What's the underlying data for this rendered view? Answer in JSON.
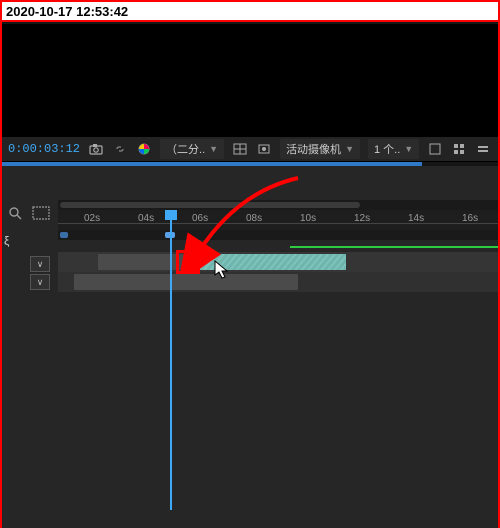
{
  "timestamp": "2020-10-17 12:53:42",
  "toolbar": {
    "timecode": "0:00:03:12",
    "comp_dropdown": "（二分..",
    "camera_dropdown": "活动摄像机",
    "view_dropdown": "1 个.."
  },
  "ruler": {
    "ticks": [
      "02s",
      "04s",
      "06s",
      "08s",
      "10s",
      "12s",
      "14s",
      "16s"
    ]
  },
  "left": {
    "axis": "ξ"
  },
  "icons": {
    "snapshot": "camera-icon",
    "link": "link-icon",
    "color": "color-wheel-icon",
    "guides": "guides-icon",
    "mask": "mask-icon",
    "toolbar_r1": "box-icon",
    "toolbar_r2": "grid-icon",
    "toolbar_r3": "settings-icon",
    "search": "search-icon",
    "region": "region-icon",
    "expand": "∨"
  },
  "colors": {
    "accent_blue": "#3fa9f5",
    "highlight_red": "#ff0000",
    "clip_teal": "#6fb5ad",
    "render_green": "#2ecc40"
  }
}
